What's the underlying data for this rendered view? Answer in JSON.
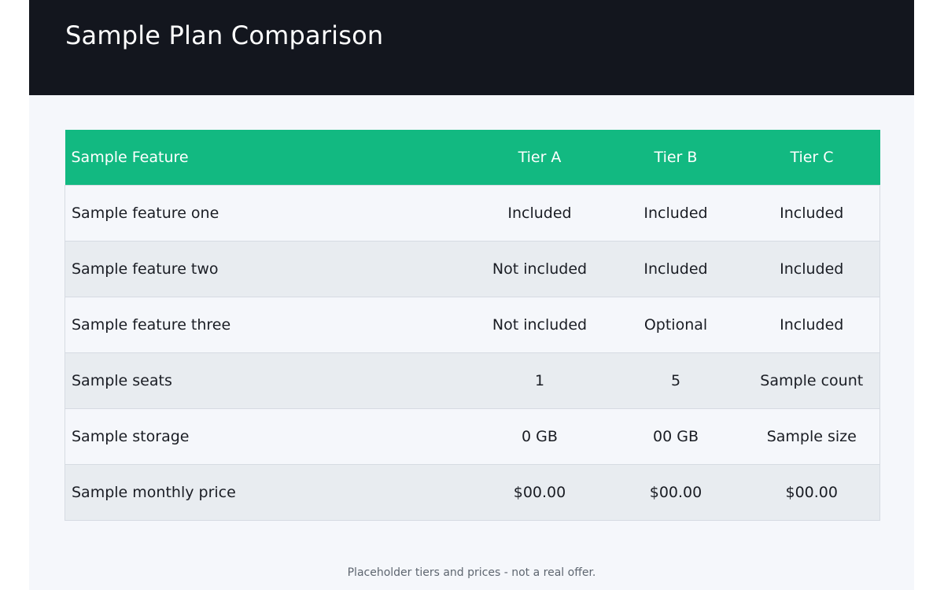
{
  "header": {
    "title": "Sample Plan Comparison"
  },
  "table": {
    "columns": [
      "Sample Feature",
      "Tier A",
      "Tier B",
      "Tier C"
    ],
    "rows": [
      [
        "Sample feature one",
        "Included",
        "Included",
        "Included"
      ],
      [
        "Sample feature two",
        "Not included",
        "Included",
        "Included"
      ],
      [
        "Sample feature three",
        "Not included",
        "Optional",
        "Included"
      ],
      [
        "Sample seats",
        "1",
        "5",
        "Sample count"
      ],
      [
        "Sample storage",
        "0 GB",
        "00 GB",
        "Sample size"
      ],
      [
        "Sample monthly price",
        "$00.00",
        "$00.00",
        "$00.00"
      ]
    ]
  },
  "footnote": "Placeholder tiers and prices - not a real offer.",
  "colors": {
    "header_bg": "#13161e",
    "table_header_bg": "#12b981",
    "page_bg": "#f5f7fb",
    "row_alt_bg": "#e8ecf0"
  }
}
